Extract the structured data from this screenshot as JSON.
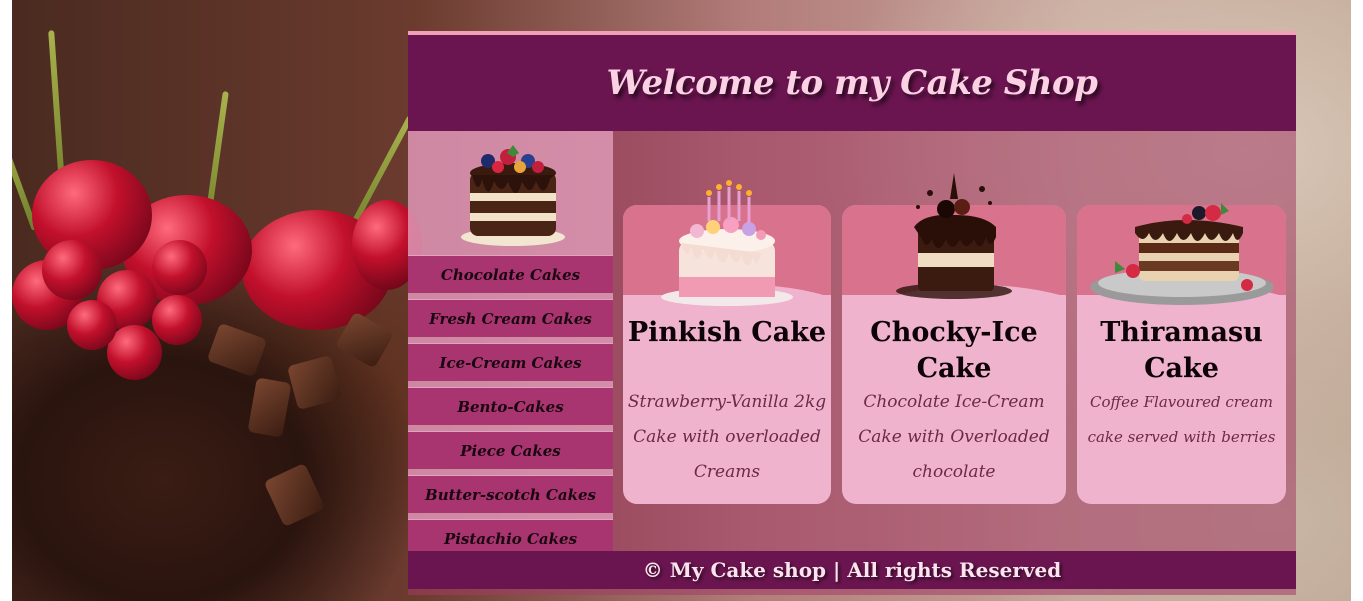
{
  "header": {
    "title": "Welcome to my Cake Shop"
  },
  "sidebar": {
    "menu": [
      "Chocolate Cakes",
      "Fresh Cream Cakes",
      "Ice-Cream Cakes",
      "Bento-Cakes",
      "Piece Cakes",
      "Butter-scotch Cakes",
      "Pistachio Cakes"
    ]
  },
  "cards": [
    {
      "title": "Pinkish Cake",
      "description": "Strawberry-Vanilla 2kg Cake with overloaded Creams"
    },
    {
      "title": "Chocky-Ice Cake",
      "description": "Chocolate Ice-Cream Cake with Overloaded chocolate"
    },
    {
      "title": "Thiramasu Cake",
      "description": "Coffee Flavoured cream cake served with berries"
    }
  ],
  "footer": {
    "text": "© My Cake shop | All rights Reserved"
  },
  "colors": {
    "header_bg": "#6b1550",
    "menu_bg": "#a8356f",
    "card_bg": "#f0b3cd",
    "card_top": "#d8728d"
  }
}
